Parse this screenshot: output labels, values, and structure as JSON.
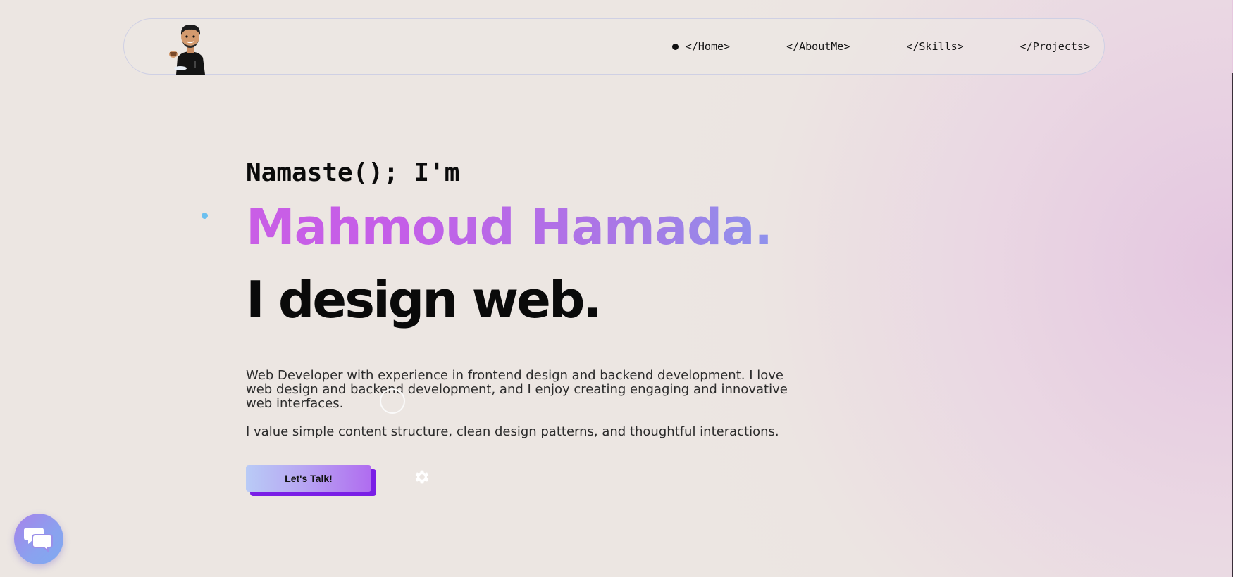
{
  "nav": {
    "items": [
      {
        "label": "</Home>",
        "active": true
      },
      {
        "label": "</AboutMe>",
        "active": false
      },
      {
        "label": "</Skills>",
        "active": false
      },
      {
        "label": "</Projects>",
        "active": false
      }
    ]
  },
  "hero": {
    "greeting": "Namaste(); I'm",
    "name": "Mahmoud Hamada.",
    "tagline": "I design web.",
    "paragraph1": "Web Developer with experience in frontend design and backend development. I love web design and backend development, and I enjoy creating engaging and innovative web interfaces.",
    "paragraph2": "I value simple content structure, clean design patterns, and thoughtful interactions.",
    "cta_label": "Let's Talk!"
  },
  "icons": {
    "logo": "avatar-icon",
    "settings": "gear-icon",
    "chat": "chat-bubbles-icon",
    "nav_active": "dot-icon"
  },
  "colors": {
    "name_gradient_start": "#c95ee6",
    "name_gradient_end": "#8f92ec",
    "cta_shadow": "#7a1ee6",
    "chat_gradient_start": "#a782ea",
    "chat_gradient_end": "#7eaaf0"
  }
}
